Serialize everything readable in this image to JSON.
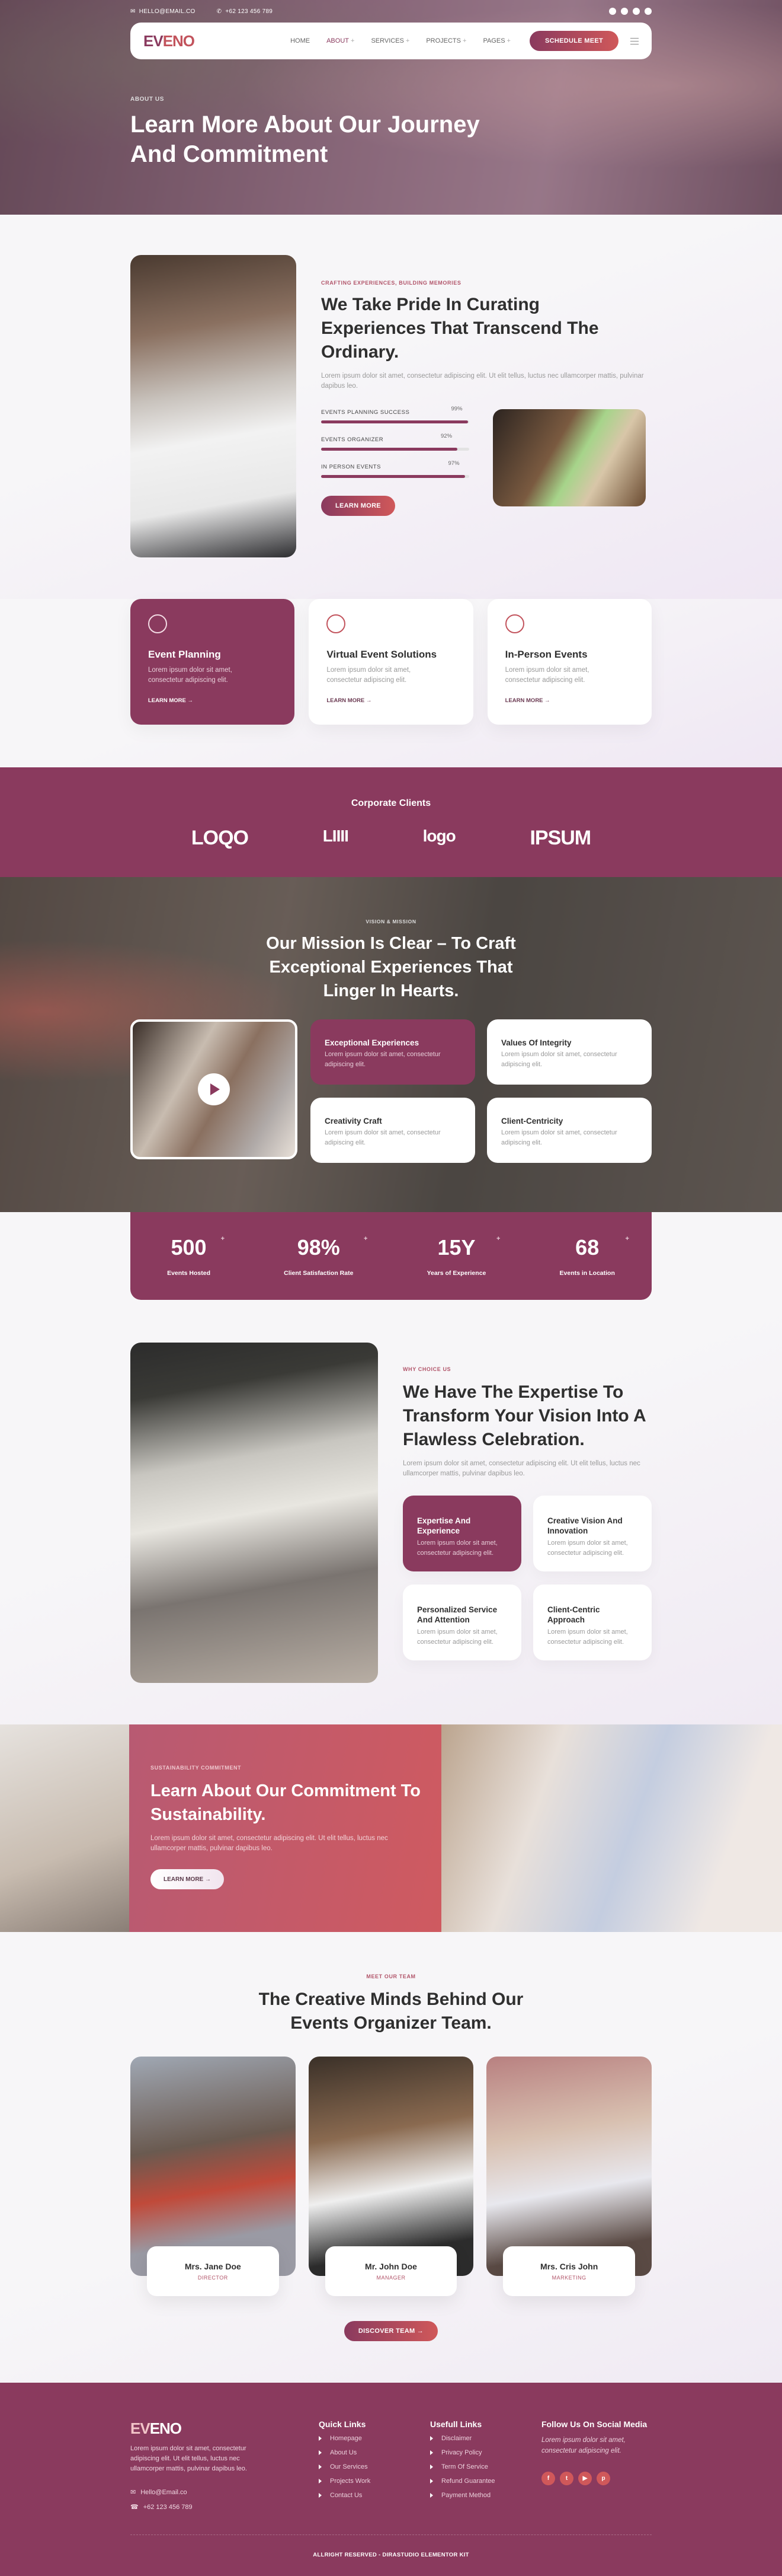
{
  "topbar": {
    "email": "HELLO@EMAIL.CO",
    "phone": "+62 123 456 789",
    "social": [
      "facebook-icon",
      "twitter-icon",
      "youtube-icon",
      "pinterest-icon"
    ]
  },
  "nav": {
    "logo": {
      "prefix": "EV",
      "suffix": "ENO"
    },
    "items": [
      {
        "label": "HOME",
        "has_sub": false
      },
      {
        "label": "ABOUT",
        "has_sub": true,
        "active": true
      },
      {
        "label": "SERVICES",
        "has_sub": true
      },
      {
        "label": "PROJECTS",
        "has_sub": true
      },
      {
        "label": "PAGES",
        "has_sub": true
      }
    ],
    "plus": "+",
    "cta": "SCHEDULE MEET"
  },
  "hero": {
    "kicker": "ABOUT US",
    "title": "Learn More About Our Journey And Commitment"
  },
  "about": {
    "kicker": "CRAFTING EXPERIENCES, BUILDING MEMORIES",
    "title": "We Take Pride In Curating Experiences That Transcend The Ordinary.",
    "text": "Lorem ipsum dolor sit amet, consectetur adipiscing elit. Ut elit tellus, luctus nec ullamcorper mattis, pulvinar dapibus leo.",
    "skills": [
      {
        "label": "EVENTS PLANNING SUCCESS",
        "value": 99,
        "display": "99%"
      },
      {
        "label": "EVENTS ORGANIZER",
        "value": 92,
        "display": "92%"
      },
      {
        "label": "IN PERSON EVENTS",
        "value": 97,
        "display": "97%"
      }
    ],
    "cta": "LEARN MORE"
  },
  "services": [
    {
      "title": "Event Planning",
      "text": "Lorem ipsum dolor sit amet, consectetur adipiscing elit.",
      "link": "LEARN MORE →",
      "icon": "lightbulb-gear-icon",
      "active": true
    },
    {
      "title": "Virtual Event Solutions",
      "text": "Lorem ipsum dolor sit amet, consectetur adipiscing elit.",
      "link": "LEARN MORE →",
      "icon": "headset-icon"
    },
    {
      "title": "In-Person Events",
      "text": "Lorem ipsum dolor sit amet, consectetur adipiscing elit.",
      "link": "LEARN MORE →",
      "icon": "person-stars-icon"
    }
  ],
  "clients": {
    "title": "Corporate Clients",
    "logos": [
      "LOQO",
      "LIIII",
      "logo",
      "IPSUM"
    ]
  },
  "mission": {
    "kicker": "VISION & MISSION",
    "title": "Our Mission Is Clear – To Craft Exceptional Experiences That Linger In Hearts.",
    "cards": [
      {
        "title": "Exceptional Experiences",
        "text": "Lorem ipsum dolor sit amet, consectetur adipiscing elit.",
        "active": true
      },
      {
        "title": "Values Of Integrity",
        "text": "Lorem ipsum dolor sit amet, consectetur adipiscing elit."
      },
      {
        "title": "Creativity Craft",
        "text": "Lorem ipsum dolor sit amet, consectetur adipiscing elit."
      },
      {
        "title": "Client-Centricity",
        "text": "Lorem ipsum dolor sit amet, consectetur adipiscing elit."
      }
    ]
  },
  "stats": [
    {
      "value": "500",
      "suffix": "+",
      "label": "Events Hosted"
    },
    {
      "value": "98%",
      "suffix": "+",
      "label": "Client Satisfaction Rate"
    },
    {
      "value": "15Y",
      "suffix": "+",
      "label": "Years of Experience"
    },
    {
      "value": "68",
      "suffix": "+",
      "label": "Events in Location"
    }
  ],
  "why": {
    "kicker": "WHY CHOICE US",
    "title": "We Have The Expertise To Transform Your Vision Into A Flawless Celebration.",
    "text": "Lorem ipsum dolor sit amet, consectetur adipiscing elit. Ut elit tellus, luctus nec ullamcorper mattis, pulvinar dapibus leo.",
    "cards": [
      {
        "title": "Expertise And Experience",
        "text": "Lorem ipsum dolor sit amet, consectetur adipiscing elit.",
        "active": true
      },
      {
        "title": "Creative Vision And Innovation",
        "text": "Lorem ipsum dolor sit amet, consectetur adipiscing elit."
      },
      {
        "title": "Personalized Service And Attention",
        "text": "Lorem ipsum dolor sit amet, consectetur adipiscing elit."
      },
      {
        "title": "Client-Centric Approach",
        "text": "Lorem ipsum dolor sit amet, consectetur adipiscing elit."
      }
    ]
  },
  "sustain": {
    "kicker": "SUSTAINABILITY COMMITMENT",
    "title": "Learn About Our Commitment To Sustainability.",
    "text": "Lorem ipsum dolor sit amet, consectetur adipiscing elit. Ut elit tellus, luctus nec ullamcorper mattis, pulvinar dapibus leo.",
    "cta": "LEARN MORE  →"
  },
  "team": {
    "kicker": "MEET OUR TEAM",
    "title": "The Creative Minds Behind Our Events Organizer Team.",
    "members": [
      {
        "name": "Mrs. Jane Doe",
        "role": "DIRECTOR"
      },
      {
        "name": "Mr. John Doe",
        "role": "MANAGER"
      },
      {
        "name": "Mrs. Cris John",
        "role": "MARKETING"
      }
    ],
    "cta": "DISCOVER TEAM  →"
  },
  "footer": {
    "text": "Lorem ipsum dolor sit amet, consectetur adipiscing elit. Ut elit tellus, luctus nec ullamcorper mattis, pulvinar dapibus leo.",
    "email": "Hello@Email.co",
    "phone": "+62 123 456 789",
    "quick_title": "Quick Links",
    "quick": [
      "Homepage",
      "About Us",
      "Our Services",
      "Projects Work",
      "Contact Us"
    ],
    "useful_title": "Usefull Links",
    "useful": [
      "Disclaimer",
      "Privacy Policy",
      "Term Of Service",
      "Refund Guarantee",
      "Payment Method"
    ],
    "social_title": "Follow Us On Social Media",
    "social_text": "Lorem ipsum dolor sit amet, consectetur adipiscing elit.",
    "social": [
      {
        "icon": "facebook-icon",
        "glyph": "f"
      },
      {
        "icon": "twitter-icon",
        "glyph": "t"
      },
      {
        "icon": "youtube-icon",
        "glyph": "▶"
      },
      {
        "icon": "pinterest-icon",
        "glyph": "p"
      }
    ],
    "copyright": "ALLRIGHT RESERVED - DIRASTUDIO ELEMENTOR KIT"
  },
  "colors": {
    "primary": "#8a3a5e",
    "accent": "#d0585a",
    "text": "#2f2f2f",
    "muted": "#9a9a9a"
  }
}
